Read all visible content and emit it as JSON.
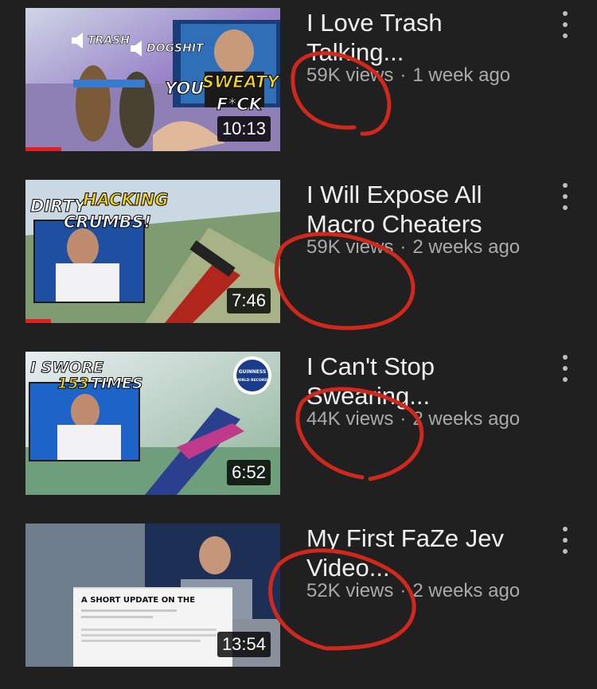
{
  "videos": [
    {
      "title": "I Love Trash Talking...",
      "views": "59K views",
      "age": "1 week ago",
      "duration": "10:13",
      "watched_fraction": 0.14,
      "thumb_text": [
        "TRASH",
        "DOGSHIT",
        "YOU",
        "SWEATY",
        "F*CK"
      ]
    },
    {
      "title": "I Will Expose All Macro Cheaters",
      "views": "59K views",
      "age": "2 weeks ago",
      "duration": "7:46",
      "watched_fraction": 0.1,
      "thumb_text": [
        "DIRTY",
        "HACKING",
        "CRUMBS!"
      ]
    },
    {
      "title": "I Can't Stop Swearing...",
      "views": "44K views",
      "age": "2 weeks ago",
      "duration": "6:52",
      "watched_fraction": 0,
      "thumb_text": [
        "I SWORE",
        "153",
        "TIMES",
        "GUINNESS",
        "WORLD RECORDS"
      ]
    },
    {
      "title": "My First FaZe Jev Video...",
      "views": "52K views",
      "age": "2 weeks ago",
      "duration": "13:54",
      "watched_fraction": 0,
      "thumb_text": [
        "A SHORT UPDATE ON THE"
      ]
    }
  ],
  "separator": "·",
  "colors": {
    "background": "#202020",
    "title": "#f1f1f1",
    "meta": "#aaaaaa",
    "progress": "#e02020",
    "annotation": "#d0281c",
    "highlight_yellow": "#f5d21a"
  },
  "icons": [
    "more-vert-icon",
    "speaker-icon",
    "guinness-badge-icon"
  ]
}
